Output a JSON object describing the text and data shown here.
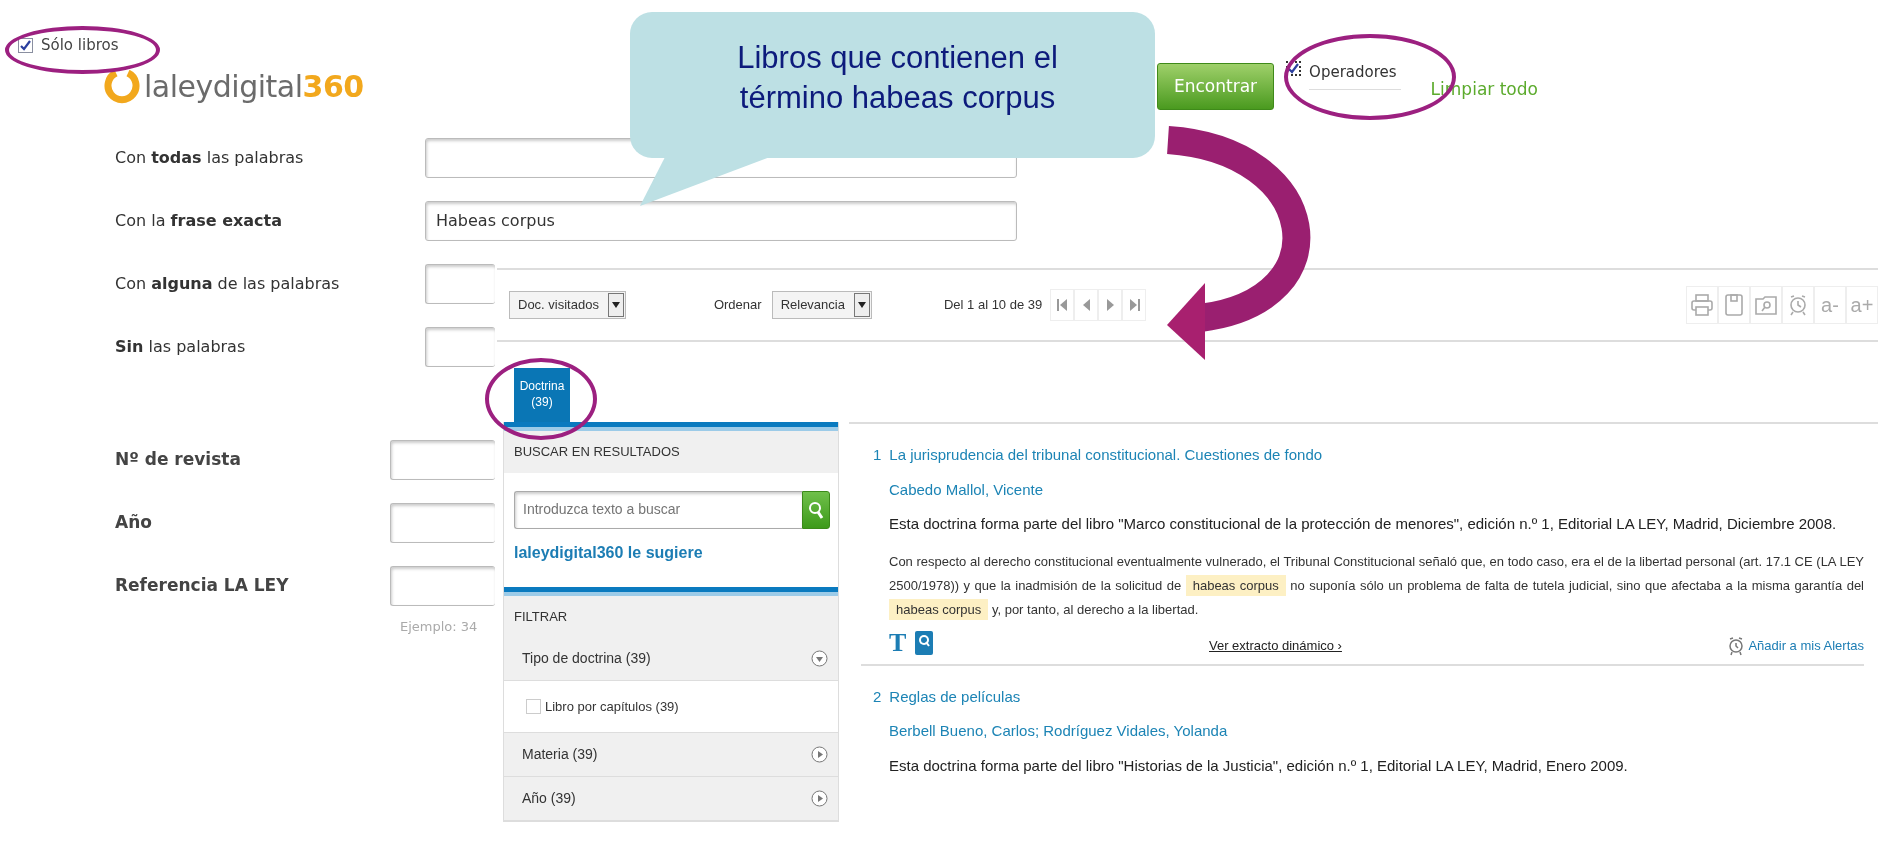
{
  "top_filter": {
    "label": "Sólo libros",
    "checked": true
  },
  "logo": {
    "name": "laleydigital",
    "accent": "360"
  },
  "search_fields": [
    {
      "label": "Con **todas** las palabras"
    },
    {
      "label": "Con la **frase exacta**",
      "value": "Habeas corpus"
    },
    {
      "label": "Con **alguna** de las palabras"
    },
    {
      "label": "**Sin** las palabras"
    }
  ],
  "reference_fields": [
    {
      "label": "Nº de revista"
    },
    {
      "label": "Año"
    },
    {
      "label": "Referencia LA LEY"
    }
  ],
  "example_hint": "Ejemplo: 34",
  "find_button": "Encontrar",
  "operators": {
    "label": "Operadores",
    "checked": true
  },
  "clear_link": "Limpiar todo",
  "results": {
    "visited_select": "Doc. visitados",
    "sort_label": "Ordenar",
    "sort_select": "Relevancia",
    "range": "Del 1 al 10 de 39",
    "font_buttons": [
      "a-",
      "a+"
    ],
    "tabs": [
      {
        "label": "Doctrina",
        "count": "(39)",
        "selected": true
      }
    ],
    "sidebar": {
      "search_title": "BUSCAR EN RESULTADOS",
      "search_placeholder": "Introduzca texto a buscar",
      "suggest": "laleydigital360 le sugiere",
      "filter_title": "FILTRAR",
      "facets": [
        {
          "label": "Tipo de doctrina (39)",
          "expanded": true,
          "options": [
            {
              "label": "Libro por capítulos (39)",
              "checked": false
            }
          ]
        },
        {
          "label": "Materia (39)",
          "expanded": false
        },
        {
          "label": "Año (39)",
          "expanded": false
        }
      ]
    },
    "items": [
      {
        "number": "1",
        "title": "La jurisprudencia del tribunal constitucional. Cuestiones de fondo",
        "authors": "Cabedo Mallol, Vicente",
        "source": "Esta doctrina forma parte del libro \"Marco constitucional de la protección de menores\", edición n.º 1, Editorial LA LEY, Madrid, Diciembre 2008.",
        "snippet": [
          {
            "text": "Con respecto al derecho constitucional eventualmente vulnerado, el Tribunal Constitucional señaló que, en todo caso, era el de la libertad personal (art. 17.1 CE (LA LEY 2500/1978)) y que la inadmisión de la solicitud de ",
            "highlight": false
          },
          {
            "text": "habeas corpus",
            "highlight": true
          },
          {
            "text": " no suponía sólo un problema de falta de tutela judicial, sino que afectaba a la misma garantía del ",
            "highlight": false
          },
          {
            "text": "habeas corpus",
            "highlight": true
          },
          {
            "text": " y, por tanto, al derecho a la libertad.",
            "highlight": false
          }
        ],
        "text_icon": "T",
        "extract_link": "Ver extracto dinámico ›",
        "alert_link": "Añadir a mis Alertas"
      },
      {
        "number": "2",
        "title": "Reglas de películas",
        "authors": "Berbell Bueno, Carlos; Rodríguez Vidales, Yolanda",
        "source": "Esta doctrina forma parte del libro \"Historias de la Justicia\", edición n.º 1, Editorial LA LEY, Madrid, Enero 2009."
      }
    ]
  },
  "callout": {
    "text": "Libros que contienen el término habeas corpus"
  }
}
